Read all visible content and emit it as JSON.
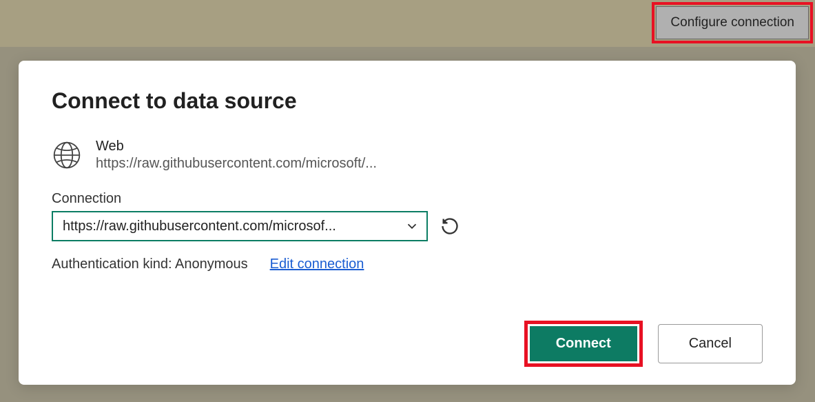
{
  "header": {
    "configure_label": "Configure connection"
  },
  "dialog": {
    "title": "Connect to data source",
    "source": {
      "name": "Web",
      "url": "https://raw.githubusercontent.com/microsoft/..."
    },
    "connection": {
      "label": "Connection",
      "value": "https://raw.githubusercontent.com/microsof..."
    },
    "auth": {
      "text": "Authentication kind: Anonymous",
      "edit_label": "Edit connection"
    },
    "buttons": {
      "connect": "Connect",
      "cancel": "Cancel"
    }
  }
}
